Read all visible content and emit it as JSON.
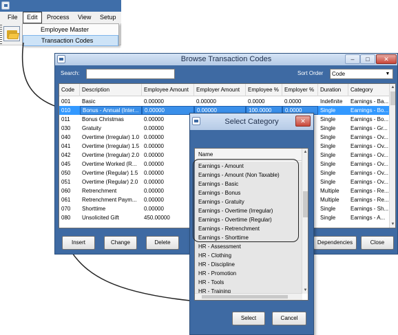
{
  "menu": {
    "items": [
      {
        "label": "File"
      },
      {
        "label": "Edit"
      },
      {
        "label": "Process"
      },
      {
        "label": "View"
      },
      {
        "label": "Setup"
      }
    ],
    "edit_dropdown": [
      {
        "label": "Employee Master"
      },
      {
        "label": "Transaction Codes"
      }
    ]
  },
  "browse": {
    "title": "Browse Transaction Codes",
    "search_label": "Search:",
    "search_value": "",
    "sort_label": "Sort Order",
    "sort_value": "Code",
    "columns": [
      "Code",
      "Description",
      "Employee Amount",
      "Employer Amount",
      "Employee %",
      "Employer %",
      "Duration",
      "Category"
    ],
    "rows": [
      [
        "001",
        "Basic",
        "0.00000",
        "0.00000",
        "0.0000",
        "0.0000",
        "Indefinite",
        "Earnings - Ba..."
      ],
      [
        "010",
        "Bonus - Annual (Inter...",
        "0.00000",
        "0.00000",
        "100.0000",
        "0.0000",
        "Single",
        "Earnings - Bo..."
      ],
      [
        "011",
        "Bonus Christmas",
        "0.00000",
        "",
        "",
        "",
        "Single",
        "Earnings - Bo..."
      ],
      [
        "030",
        "Gratuity",
        "0.00000",
        "",
        "",
        "",
        "Single",
        "Earnings - Gr..."
      ],
      [
        "040",
        "Overtime (Irregular) 1.0",
        "0.00000",
        "",
        "",
        "",
        "Single",
        "Earnings - Ov..."
      ],
      [
        "041",
        "Overtime (Irregular) 1.5",
        "0.00000",
        "",
        "",
        "",
        "Single",
        "Earnings - Ov..."
      ],
      [
        "042",
        "Overtime (Irregular) 2.0",
        "0.00000",
        "",
        "",
        "",
        "Single",
        "Earnings - Ov..."
      ],
      [
        "045",
        "Overtime Worked (R...",
        "0.00000",
        "",
        "",
        "",
        "Single",
        "Earnings - Ov..."
      ],
      [
        "050",
        "Overtime (Regular) 1.5",
        "0.00000",
        "",
        "",
        "",
        "Single",
        "Earnings - Ov..."
      ],
      [
        "051",
        "Overtime (Regular) 2.0",
        "0.00000",
        "",
        "",
        "",
        "Single",
        "Earnings - Ov..."
      ],
      [
        "060",
        "Retrenchment",
        "0.00000",
        "",
        "",
        "",
        "Multiple",
        "Earnings - Re..."
      ],
      [
        "061",
        "Retrenchment Paym...",
        "0.00000",
        "",
        "",
        "",
        "Multiple",
        "Earnings - Re..."
      ],
      [
        "070",
        "Shorttime",
        "0.00000",
        "",
        "",
        "",
        "Single",
        "Earnings - Sh..."
      ],
      [
        "080",
        "Unsolicited Gift",
        "450.00000",
        "",
        "",
        "",
        "Single",
        "Earnings - A..."
      ]
    ],
    "buttons": {
      "insert": "Insert",
      "change": "Change",
      "delete": "Delete",
      "dependencies": "Dependencies",
      "close": "Close"
    }
  },
  "category": {
    "title": "Select Category",
    "column": "Name",
    "items": [
      "Earnings - Amount",
      "Earnings - Amount (Non Taxable)",
      "Earnings - Basic",
      "Earnings - Bonus",
      "Earnings - Gratuity",
      "Earnings - Overtime (Irregular)",
      "Earnings - Overtime (Regular)",
      "Earnings - Retrenchment",
      "Earnings - Shorttime",
      "HR - Assessment",
      "HR - Clothing",
      "HR - Discipline",
      "HR - Promotion",
      "HR - Tools",
      "HR - Training"
    ],
    "buttons": {
      "select": "Select",
      "cancel": "Cancel"
    }
  },
  "colors": {
    "title_blue": "#3e6aa3",
    "selection": "#3399ff",
    "close_red": "#c9473a"
  }
}
